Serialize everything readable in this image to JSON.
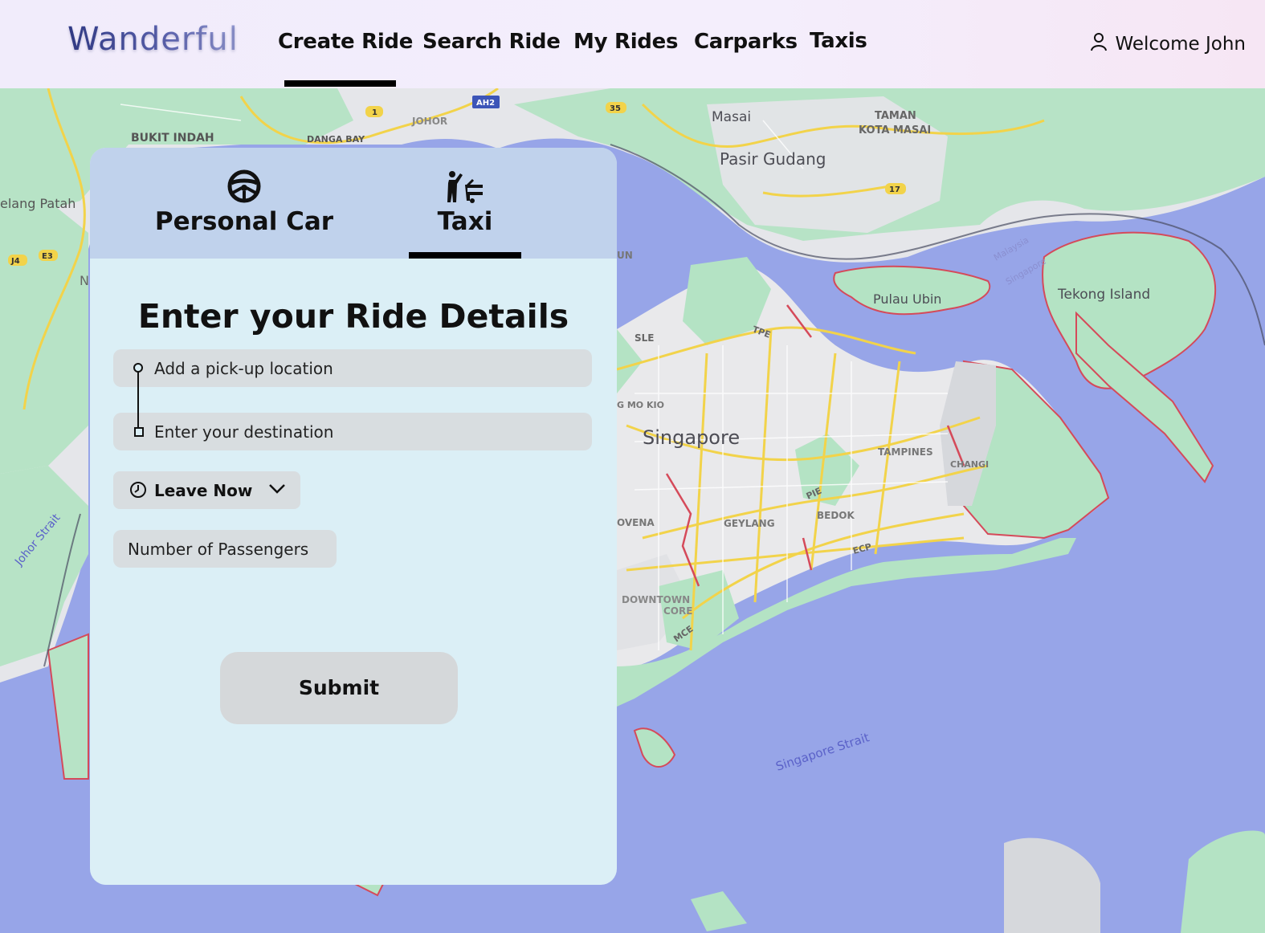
{
  "app": {
    "logo": "Wanderful"
  },
  "nav": {
    "items": [
      {
        "label": "Create Ride",
        "active": true
      },
      {
        "label": "Search Ride",
        "active": false
      },
      {
        "label": "My Rides",
        "active": false
      },
      {
        "label": "Carparks",
        "active": false
      },
      {
        "label": "Taxis",
        "active": false
      }
    ]
  },
  "user": {
    "greeting": "Welcome John",
    "icon": "user-icon"
  },
  "ride_panel": {
    "tabs": [
      {
        "label": "Personal Car",
        "icon": "steering-wheel-icon",
        "active": false
      },
      {
        "label": "Taxi",
        "icon": "taxi-hail-icon",
        "active": true
      }
    ],
    "title": "Enter your Ride Details",
    "pickup": {
      "placeholder": "Add a pick-up location",
      "value": ""
    },
    "destination": {
      "placeholder": "Enter your destination",
      "value": ""
    },
    "leave_time": {
      "selected": "Leave Now",
      "icon": "clock-icon"
    },
    "passengers": {
      "placeholder": "Number of Passengers",
      "value": ""
    },
    "submit_label": "Submit"
  },
  "map": {
    "labels": {
      "bukit_indah": "BUKIT INDAH",
      "danga_bay": "DANGA BAY",
      "johor": "JOHOR",
      "ah2": "AH2",
      "masai": "Masai",
      "taman_kota_masai_1": "TAMAN",
      "taman_kota_masai_2": "KOTA MASAI",
      "pasir_gudang": "Pasir Gudang",
      "gelang_patah": "elang Patah",
      "pulau_ubin": "Pulau Ubin",
      "tekong_island": "Tekong Island",
      "singapore": "Singapore",
      "tampines": "TAMPINES",
      "changi": "CHANGI",
      "bedok": "BEDOK",
      "geylang": "GEYLANG",
      "novena": "OVENA",
      "downtown_core_1": "DOWNTOWN",
      "downtown_core_2": "CORE",
      "johor_strait": "Johor Strait",
      "singapore_strait": "Singapore Strait",
      "malaysia_singapore_1": "Malaysia",
      "malaysia_singapore_2": "Singapore",
      "tpe": "TPE",
      "sle": "SLE",
      "pie": "PIE",
      "ecp": "ECP",
      "mce": "MCE",
      "ang_mo_kio": "G MO KIO",
      "route_1": "1",
      "route_35": "35",
      "route_17": "17",
      "route_j4": "J4",
      "route_e3": "E3",
      "un": "UN",
      "n": "N"
    },
    "colors": {
      "water": "#97a5e8",
      "land": "#e8e8ea",
      "park": "#b4e3c4",
      "road": "#f2d34a",
      "border": "#d54a5a"
    }
  },
  "colors": {
    "header_bg": "#f1ecfb",
    "tab_bar_bg": "#c0d2ec",
    "panel_bg": "#dbeff6",
    "field_bg": "#d8dde0",
    "logo": "#3d4690"
  }
}
